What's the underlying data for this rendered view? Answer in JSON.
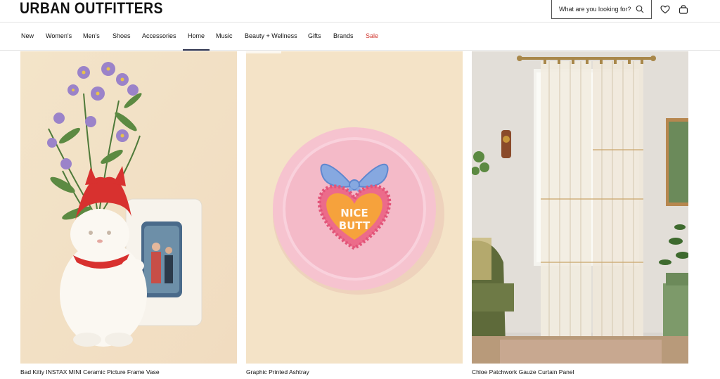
{
  "brand": {
    "logo": "URBAN OUTFITTERS"
  },
  "search": {
    "placeholder": "What are you looking for?"
  },
  "header_icons": [
    "search-icon",
    "heart-icon",
    "bag-icon"
  ],
  "nav": {
    "items": [
      {
        "label": "New"
      },
      {
        "label": "Women's"
      },
      {
        "label": "Men's"
      },
      {
        "label": "Shoes"
      },
      {
        "label": "Accessories"
      },
      {
        "label": "Home",
        "active": true
      },
      {
        "label": "Music"
      },
      {
        "label": "Beauty + Wellness"
      },
      {
        "label": "Gifts"
      },
      {
        "label": "Brands"
      },
      {
        "label": "Sale",
        "highlight": true
      }
    ],
    "sale_color": "#d0342c"
  },
  "products": [
    {
      "name": "Bad Kitty INSTAX MINI Ceramic Picture Frame Vase"
    },
    {
      "name": "Graphic Printed Ashtray",
      "image_text": "NICE BUTT"
    },
    {
      "name": "Chloe Patchwork Gauze Curtain Panel"
    }
  ]
}
